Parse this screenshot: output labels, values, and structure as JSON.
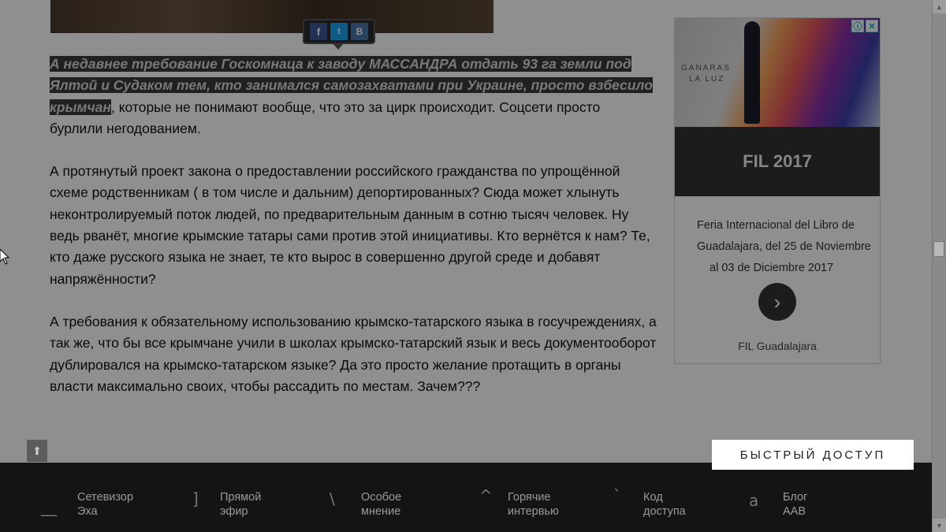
{
  "article": {
    "p1_highlight": "А недавнее требование Госкомнаца к заводу МАССАНДРА отдать  93 га земли под Ялтой и Судаком тем, кто занимался самозахватами при Украине, просто взбесило крымчан",
    "p1_rest": ", которые не  понимают вообще, что это за цирк происходит. Соцсети просто бурлили негодованием.",
    "p2": "А протянутый проект закона о предоставлении российского гражданства по упрощённой схеме родственникам ( в том числе и дальним) депортированных? Сюда может хлынуть неконтролируемый поток людей, по предварительным данным в сотню тысяч человек. Ну ведь рванёт, многие крымские татары сами против этой инициативы. Кто вернётся к нам? Те, кто даже русского языка не знает, те кто вырос в совершенно другой среде и добавят напряжённости?",
    "p3": "А требования к обязательному использованию крымско-татарского языка в госучреждениях, а так же, что бы все крымчане учили в школах крымско-татарский язык и весь документооборот дублировался на крымско-татарском языке? Да это просто желание протащить в органы власти максимально своих, чтобы рассадить по местам. Зачем???"
  },
  "share": {
    "facebook": "f",
    "twitter": "t",
    "vk": "В",
    "icons": [
      "facebook-icon",
      "twitter-icon",
      "vk-icon"
    ]
  },
  "ad": {
    "image_text_1": "GANARAS",
    "image_text_2": "LA LUZ",
    "info_icon": "ⓘ",
    "close_icon": "✕",
    "title": "FIL 2017",
    "desc_line1": "Feria Internacional del Libro de",
    "desc_line2": "Guadalajara, del 25 de Noviembre",
    "desc_line3": "al 03 de Diciembre 2017",
    "arrow": "›",
    "footer": "FIL Guadalajara"
  },
  "quick_access": "БЫСТРЫЙ ДОСТУП",
  "to_top": "⬆",
  "nav": [
    {
      "icon": "__",
      "label": "Сетевизор\nЭха"
    },
    {
      "icon": "]",
      "label": "Прямой\nэфир"
    },
    {
      "icon": "\\",
      "label": "Особое\nмнение"
    },
    {
      "icon": "^",
      "label": "Горячие\nинтервью"
    },
    {
      "icon": "`",
      "label": "Код\nдоступа"
    },
    {
      "icon": "a",
      "label": "Блог\nААВ"
    }
  ],
  "scrollbar": {
    "up": "▲",
    "down": "▼"
  }
}
